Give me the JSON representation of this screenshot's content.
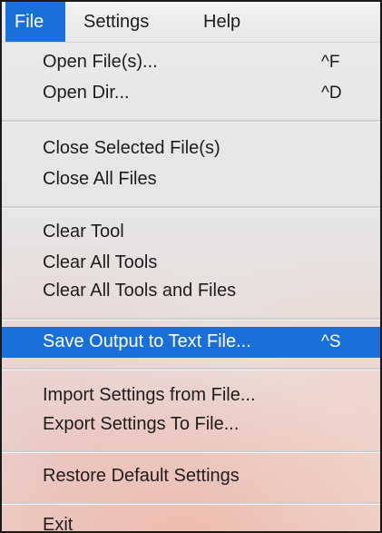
{
  "menubar": {
    "items": [
      {
        "label": "File",
        "active": true
      },
      {
        "label": "Settings",
        "active": false
      },
      {
        "label": "Help",
        "active": false
      }
    ]
  },
  "file_menu": {
    "groups": [
      [
        {
          "label": "Open File(s)...",
          "shortcut": "^F"
        },
        {
          "label": "Open Dir...",
          "shortcut": "^D"
        }
      ],
      [
        {
          "label": "Close Selected File(s)",
          "shortcut": ""
        },
        {
          "label": "Close All Files",
          "shortcut": ""
        }
      ],
      [
        {
          "label": "Clear Tool",
          "shortcut": ""
        },
        {
          "label": "Clear All Tools",
          "shortcut": ""
        },
        {
          "label": "Clear All Tools and Files",
          "shortcut": ""
        }
      ],
      [
        {
          "label": "Save Output to Text File...",
          "shortcut": "^S",
          "highlighted": true
        }
      ],
      [
        {
          "label": "Import Settings from File...",
          "shortcut": ""
        },
        {
          "label": "Export Settings To File...",
          "shortcut": ""
        }
      ],
      [
        {
          "label": "Restore Default Settings",
          "shortcut": ""
        }
      ],
      [
        {
          "label": "Exit",
          "shortcut": ""
        }
      ]
    ]
  },
  "colors": {
    "selection": "#1a6fd8",
    "text": "#1d1d1d",
    "selected_text": "#ffffff"
  }
}
